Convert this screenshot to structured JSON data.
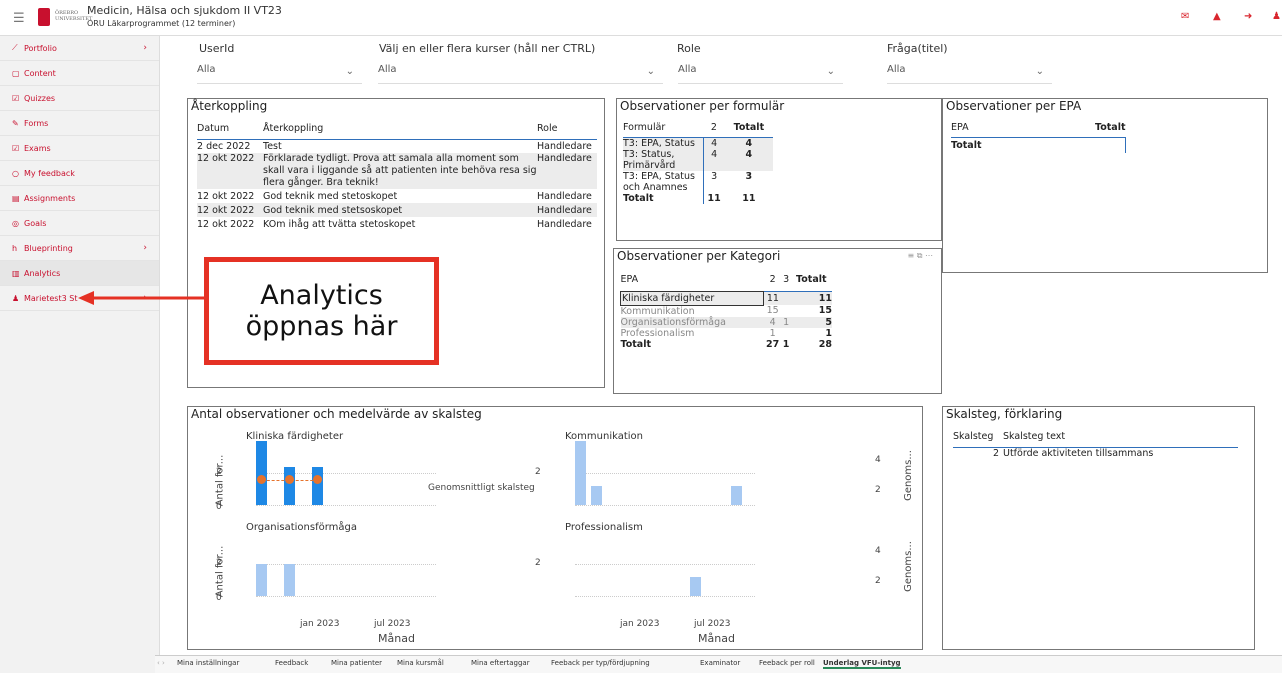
{
  "header": {
    "title": "Medicin, Hälsa och sjukdom II VT23",
    "subtitle": "ORU Läkarprogrammet (12 terminer)",
    "logo_text": "ÖREBRO UNIVERSITET"
  },
  "sidebar": {
    "items": [
      {
        "label": "Portfolio",
        "icon": "line-chart-icon",
        "glyph": "⟋",
        "chevron": "›"
      },
      {
        "label": "Content",
        "icon": "document-icon",
        "glyph": "▢",
        "chevron": ""
      },
      {
        "label": "Quizzes",
        "icon": "checkbox-icon",
        "glyph": "☑",
        "chevron": ""
      },
      {
        "label": "Forms",
        "icon": "edit-icon",
        "glyph": "✎",
        "chevron": ""
      },
      {
        "label": "Exams",
        "icon": "checkbox-icon",
        "glyph": "☑",
        "chevron": ""
      },
      {
        "label": "My feedback",
        "icon": "chat-icon",
        "glyph": "○",
        "chevron": ""
      },
      {
        "label": "Assignments",
        "icon": "file-icon",
        "glyph": "▤",
        "chevron": ""
      },
      {
        "label": "Goals",
        "icon": "target-icon",
        "glyph": "◎",
        "chevron": ""
      },
      {
        "label": "Blueprinting",
        "icon": "h-icon",
        "glyph": "h",
        "chevron": "›"
      },
      {
        "label": "Analytics",
        "icon": "bar-chart-icon",
        "glyph": "▥",
        "chevron": ""
      },
      {
        "label": "Marietest3 St",
        "icon": "user-icon",
        "glyph": "♟",
        "chevron": "›"
      }
    ]
  },
  "filters": {
    "userid_label": "UserId",
    "userid_value": "Alla",
    "course_label": "Välj en eller flera kurser (håll ner CTRL)",
    "course_value": "Alla",
    "role_label": "Role",
    "role_value": "Alla",
    "question_label": "Fråga(titel)",
    "question_value": "Alla"
  },
  "feedback": {
    "title": "Återkoppling",
    "headers": [
      "Datum",
      "Återkoppling",
      "Role"
    ],
    "rows": [
      {
        "date": "2 dec 2022",
        "text": "Test",
        "role": "Handledare"
      },
      {
        "date": "12 okt 2022",
        "text": "Förklarade tydligt. Prova att samala alla moment som skall vara i liggande så att patienten inte behöva resa sig flera gånger. Bra teknik!",
        "role": "Handledare"
      },
      {
        "date": "12 okt 2022",
        "text": "God teknik med stetoskopet",
        "role": "Handledare"
      },
      {
        "date": "12 okt 2022",
        "text": "God teknik med stetsoskopet",
        "role": "Handledare"
      },
      {
        "date": "12 okt 2022",
        "text": "KOm ihåg att tvätta stetoskopet",
        "role": "Handledare"
      }
    ]
  },
  "per_form": {
    "title": "Observationer per formulär",
    "headers": [
      "Formulär",
      "2",
      "Totalt"
    ],
    "rows": [
      {
        "name": "T3: EPA, Status",
        "v": "4",
        "t": "4"
      },
      {
        "name": "T3: Status, Primärvård",
        "v": "4",
        "t": "4"
      },
      {
        "name": "T3: EPA, Status och Anamnes",
        "v": "3",
        "t": "3"
      }
    ],
    "total_label": "Totalt",
    "total_v": "11",
    "total_t": "11"
  },
  "per_epa": {
    "title": "Observationer per EPA",
    "headers": [
      "EPA",
      "Totalt"
    ],
    "total_label": "Totalt"
  },
  "per_category": {
    "title": "Observationer per Kategori",
    "headers": [
      "EPA",
      "2",
      "3",
      "Totalt"
    ],
    "rows": [
      {
        "name": "Kliniska färdigheter",
        "a": "11",
        "b": "",
        "t": "11"
      },
      {
        "name": "Kommunikation",
        "a": "15",
        "b": "",
        "t": "15"
      },
      {
        "name": "Organisationsförmåga",
        "a": "4",
        "b": "1",
        "t": "5"
      },
      {
        "name": "Professionalism",
        "a": "1",
        "b": "",
        "t": "1"
      }
    ],
    "total_label": "Totalt",
    "total_a": "27",
    "total_b": "1",
    "total_t": "28"
  },
  "callout": {
    "line1": "Analytics",
    "line2": "öppnas här"
  },
  "chart_data": {
    "type": "bar",
    "title": "Antal observationer och medelvärde av skalsteg",
    "xlabel": "Månad",
    "ylabel_left": "Antal for...",
    "ylabel_right": "Genoms...",
    "center_label": "Genomsnittligt skalsteg",
    "x_ticks": [
      "jan 2023",
      "jul 2023"
    ],
    "left_ticks": [
      "2",
      "0"
    ],
    "right_ticks": [
      "4",
      "2"
    ],
    "panels": [
      {
        "name": "Kliniska färdigheter",
        "values": [
          4,
          2.4,
          2.4
        ],
        "highlight": true,
        "avg": [
          2,
          2,
          2
        ]
      },
      {
        "name": "Kommunikation",
        "values": [
          4,
          1.2,
          1.2
        ],
        "highlight": false
      },
      {
        "name": "Organisationsförmåga",
        "values": [
          2,
          2
        ],
        "highlight": false
      },
      {
        "name": "Professionalism",
        "values": [
          1.2
        ],
        "highlight": false
      }
    ]
  },
  "scale": {
    "title": "Skalsteg, förklaring",
    "headers": [
      "Skalsteg",
      "Skalsteg text"
    ],
    "rows": [
      {
        "step": "2",
        "text": "Utförde aktiviteten tillsammans"
      }
    ]
  },
  "tabs": [
    "Mina inställningar",
    "Feedback",
    "Mina patienter",
    "Mina kursmål",
    "Mina eftertaggar",
    "Feeback per typ/fördjupning",
    "Examinator",
    "Feeback per roll",
    "Underlag VFU-intyg"
  ]
}
